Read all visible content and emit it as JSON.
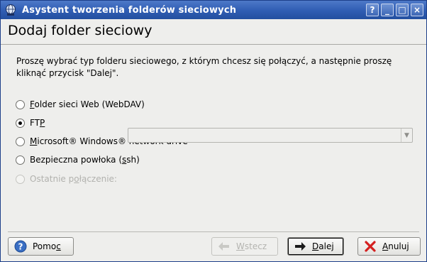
{
  "window": {
    "title": "Asystent tworzenia folderów sieciowych",
    "buttons": {
      "help": "?",
      "minimize": "_",
      "maximize": "□",
      "close": "×"
    }
  },
  "page": {
    "title": "Dodaj folder sieciowy",
    "instruction": "Proszę wybrać typ folderu sieciowego, z którym chcesz się połączyć, a następnie proszę kliknąć przycisk \"Dalej\"."
  },
  "options": [
    {
      "pre": "",
      "mn": "F",
      "post": "older sieci Web (WebDAV)",
      "checked": false,
      "enabled": true
    },
    {
      "pre": "FT",
      "mn": "P",
      "post": "",
      "checked": true,
      "enabled": true
    },
    {
      "pre": "",
      "mn": "M",
      "post": "icrosoft® Windows® network drive",
      "checked": false,
      "enabled": true
    },
    {
      "pre": "Bezpieczna powłoka (",
      "mn": "s",
      "post": "sh)",
      "checked": false,
      "enabled": true
    },
    {
      "pre": "Ostatnie p",
      "mn": "o",
      "post": "łączenie:",
      "checked": false,
      "enabled": false
    }
  ],
  "recent_connection": {
    "value": ""
  },
  "footer": {
    "help": {
      "pre": "Pomo",
      "mn": "c",
      "post": ""
    },
    "back": {
      "pre": "",
      "mn": "W",
      "post": "stecz"
    },
    "next": {
      "pre": "",
      "mn": "D",
      "post": "alej"
    },
    "cancel": {
      "pre": "",
      "mn": "A",
      "post": "nuluj"
    }
  },
  "colors": {
    "titlebar": "#2f5db3",
    "window_bg": "#eeeeec",
    "disabled_text": "#b2b2ae"
  },
  "icons": {
    "app": "network-folder-icon",
    "help": "help-icon",
    "back": "back-arrow-icon",
    "next": "next-arrow-icon",
    "cancel": "cancel-x-icon"
  }
}
